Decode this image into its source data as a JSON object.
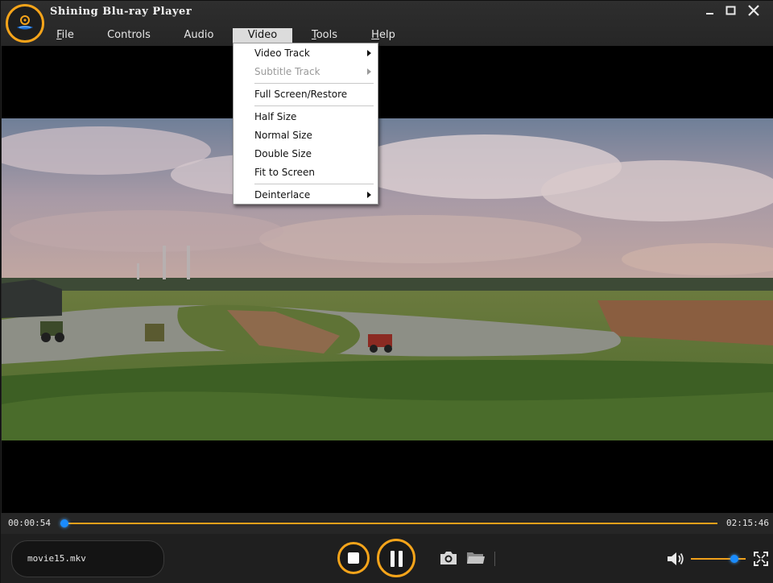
{
  "window": {
    "title": "Shining Blu-ray Player"
  },
  "menubar": {
    "items": [
      {
        "label": "File",
        "mnemonic": "F"
      },
      {
        "label": "Controls",
        "mnemonic": ""
      },
      {
        "label": "Audio",
        "mnemonic": ""
      },
      {
        "label": "Video",
        "mnemonic": "",
        "active": true
      },
      {
        "label": "Tools",
        "mnemonic": "T"
      },
      {
        "label": "Help",
        "mnemonic": "H"
      }
    ]
  },
  "video_menu": {
    "items": [
      {
        "label": "Video Track",
        "submenu": true,
        "enabled": true
      },
      {
        "label": "Subtitle Track",
        "submenu": true,
        "enabled": false
      },
      {
        "label": "Full Screen/Restore",
        "submenu": false,
        "enabled": true
      },
      {
        "label": "Half Size",
        "submenu": false,
        "enabled": true
      },
      {
        "label": "Normal Size",
        "submenu": false,
        "enabled": true
      },
      {
        "label": "Double Size",
        "submenu": false,
        "enabled": true
      },
      {
        "label": "Fit to Screen",
        "submenu": false,
        "enabled": true
      },
      {
        "label": "Deinterlace",
        "submenu": true,
        "enabled": true
      }
    ]
  },
  "playback": {
    "current_time": "00:00:54",
    "total_time": "02:15:46",
    "progress_fraction": 0.0066,
    "file_name": "movie15.mkv",
    "volume_fraction": 0.8,
    "state": "playing"
  },
  "icons": {
    "app_logo": "disc-logo-icon",
    "minimize": "minimize-icon",
    "maximize": "maximize-icon",
    "close": "close-icon",
    "stop": "stop-icon",
    "pause": "pause-icon",
    "snapshot": "camera-icon",
    "open_folder": "folder-icon",
    "volume": "speaker-icon",
    "fullscreen": "fullscreen-icon"
  },
  "colors": {
    "accent": "#f5a41a",
    "knob": "#1a8cff",
    "background": "#232323"
  }
}
